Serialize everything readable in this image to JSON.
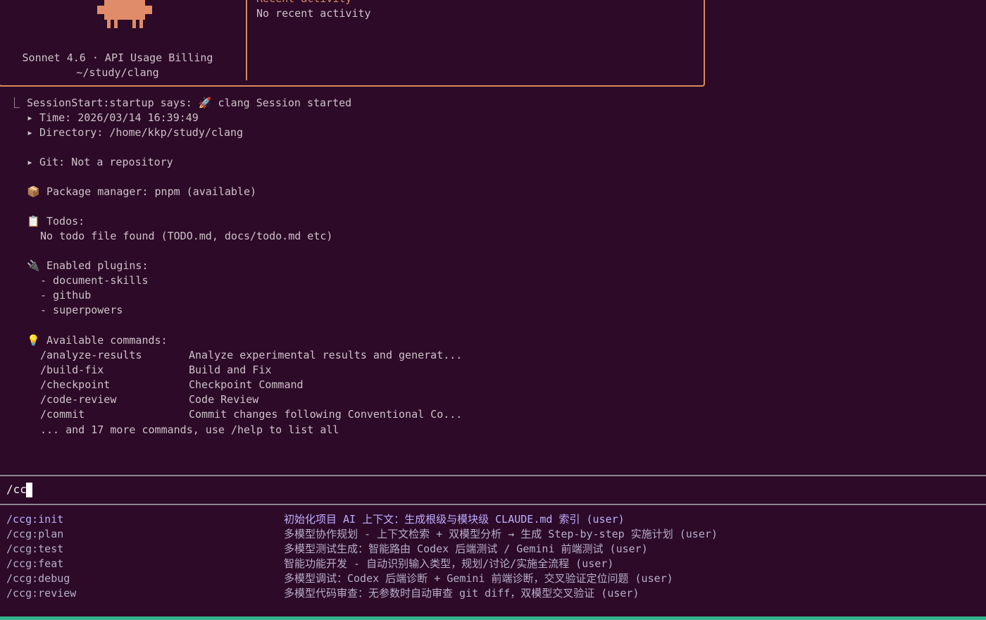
{
  "header": {
    "recent_title": "Recent activity",
    "recent_text": "No recent activity",
    "model_line": "Sonnet 4.6 · API Usage Billing",
    "cwd_line": "~/study/clang"
  },
  "session": {
    "start_line": "SessionStart:startup says: 🚀 clang Session started",
    "time_line": "▸ Time: 2026/03/14 16:39:49",
    "dir_line": "▸ Directory: /home/kkp/study/clang",
    "git_line": "▸ Git: Not a repository",
    "pkg_line": "Package manager: pnpm (available)",
    "todos_title": "Todos:",
    "todos_text": "No todo file found (TODO.md, docs/todo.md etc)",
    "plugins_title": "Enabled plugins:",
    "plugins": [
      "- document-skills",
      "- github",
      "- superpowers"
    ],
    "commands_title": "Available commands:",
    "commands": [
      {
        "name": "/analyze-results",
        "desc": "Analyze experimental results and generat..."
      },
      {
        "name": "/build-fix",
        "desc": "Build and Fix"
      },
      {
        "name": "/checkpoint",
        "desc": "Checkpoint Command"
      },
      {
        "name": "/code-review",
        "desc": "Code Review"
      },
      {
        "name": "/commit",
        "desc": "Commit changes following Conventional Co..."
      }
    ],
    "more_line": "... and 17 more commands, use /help to list all"
  },
  "input": {
    "value": "/cc"
  },
  "suggestions": [
    {
      "name": "/ccg:init",
      "desc": "初始化项目 AI 上下文：生成根级与模块级 CLAUDE.md 索引 (user)"
    },
    {
      "name": "/ccg:plan",
      "desc": "多模型协作规划 - 上下文检索 + 双模型分析 → 生成 Step-by-step 实施计划 (user)"
    },
    {
      "name": "/ccg:test",
      "desc": "多模型测试生成：智能路由 Codex 后端测试 / Gemini 前端测试 (user)"
    },
    {
      "name": "/ccg:feat",
      "desc": "智能功能开发 - 自动识别输入类型，规划/讨论/实施全流程 (user)"
    },
    {
      "name": "/ccg:debug",
      "desc": "多模型调试：Codex 后端诊断 + Gemini 前端诊断，交叉验证定位问题 (user)"
    },
    {
      "name": "/ccg:review",
      "desc": "多模型代码审查：无参数时自动审查 git diff，双模型交叉验证 (user)"
    }
  ],
  "colors": {
    "background": "#2c0a28",
    "accent": "#d98a5c",
    "suggestion_selected": "#bfaeff",
    "status_strip": "#2fb38a"
  },
  "icons": {
    "tree": "tree-corner-icon",
    "package": "package-icon",
    "clipboard": "clipboard-icon",
    "plug": "plug-icon",
    "bulb": "lightbulb-icon"
  }
}
